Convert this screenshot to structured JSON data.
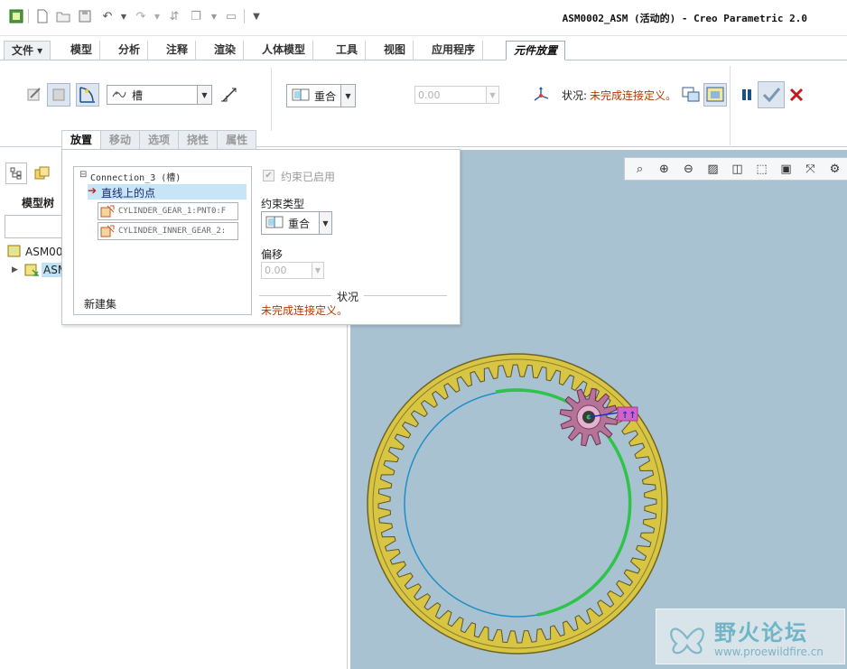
{
  "window": {
    "title": "ASM0002_ASM (活动的) - Creo Parametric 2.0"
  },
  "ribbon_tabs": [
    {
      "label": "文件 ▾"
    },
    {
      "label": "模型"
    },
    {
      "label": "分析"
    },
    {
      "label": "注释"
    },
    {
      "label": "渲染"
    },
    {
      "label": "人体模型"
    },
    {
      "label": "工具"
    },
    {
      "label": "视图"
    },
    {
      "label": "应用程序"
    },
    {
      "label": "元件放置"
    }
  ],
  "toolbar": {
    "connection_type": "槽",
    "constraint_type": "重合",
    "offset_value": "0.00",
    "status_label": "状况:",
    "status_value": "未完成连接定义。"
  },
  "panel_tabs": [
    {
      "label": "放置"
    },
    {
      "label": "移动"
    },
    {
      "label": "选项"
    },
    {
      "label": "挠性"
    },
    {
      "label": "属性"
    }
  ],
  "placement": {
    "connection_name": "Connection_3 (槽)",
    "constraint_item": "直线上的点",
    "references": [
      "CYLINDER_GEAR_1:PNT0:F",
      "CYLINDER_INNER_GEAR_2:"
    ],
    "new_set": "新建集",
    "enabled_label": "约束已启用",
    "constraint_type_label": "约束类型",
    "constraint_type_value": "重合",
    "offset_label": "偏移",
    "offset_value": "0.00",
    "status_heading": "状况",
    "status_message": "未完成连接定义。"
  },
  "model_tree": {
    "label": "模型树",
    "root": "ASM00",
    "child": "ASM"
  },
  "watermark": {
    "brand": "野火论坛",
    "url": "www.proewildfire.cn"
  },
  "colors": {
    "background_3d": "#a9c2d1",
    "gear_outer": "#d8c544",
    "gear_pinion": "#b57397",
    "slot_path": "#2ec44a",
    "circle_line": "#1d8ec9",
    "status_text": "#b03a00",
    "selected_row": "#c8e4f7"
  }
}
